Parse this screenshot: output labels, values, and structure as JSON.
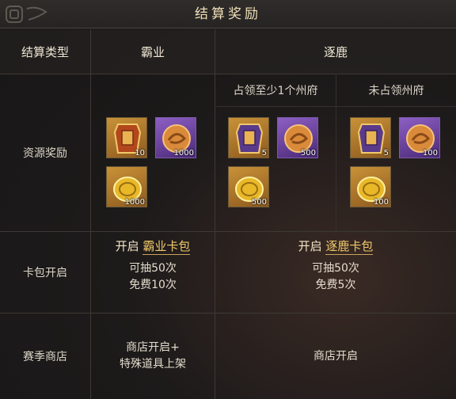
{
  "title": "结算奖励",
  "headers": {
    "type": "结算类型",
    "hegemony": "霸业",
    "chase": "逐鹿",
    "chase_sub_a": "占领至少1个州府",
    "chase_sub_b": "未占领州府"
  },
  "rows": {
    "resources": "资源奖励",
    "card_pack": "卡包开启",
    "shop": "赛季商店"
  },
  "items": {
    "hegemony": [
      "10",
      "1000",
      "1000"
    ],
    "chase_a": [
      "5",
      "500",
      "500"
    ],
    "chase_b": [
      "5",
      "100",
      "100"
    ]
  },
  "icons": [
    "token-badge-icon",
    "jade-orb-icon",
    "gold-coin-icon"
  ],
  "card_pack": {
    "hegemony_prefix": "开启",
    "hegemony_link": "霸业卡包",
    "hegemony_draws": "可抽50次",
    "hegemony_free": "免费10次",
    "chase_prefix": "开启",
    "chase_link": "逐鹿卡包",
    "chase_draws": "可抽50次",
    "chase_free": "免费5次"
  },
  "shop": {
    "hegemony_line1": "商店开启+",
    "hegemony_line2": "特殊道具上架",
    "chase": "商店开启"
  },
  "colors": {
    "accent_gold": "#f0c96b",
    "title_text": "#f0dfb8",
    "grid_line": "#3d3935"
  }
}
